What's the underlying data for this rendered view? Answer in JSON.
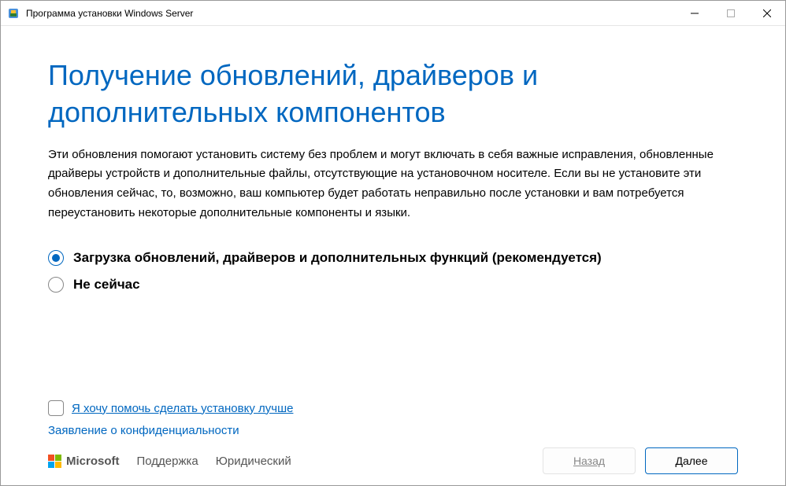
{
  "window": {
    "title": "Программа установки Windows Server"
  },
  "page": {
    "heading": "Получение обновлений, драйверов и дополнительных компонентов",
    "description": "Эти обновления помогают установить систему без проблем и могут включать в себя важные исправления, обновленные драйверы устройств и дополнительные файлы, отсутствующие на установочном носителе. Если вы не установите эти обновления сейчас, то, возможно, ваш компьютер будет работать неправильно после установки и вам потребуется переустановить некоторые дополнительные компоненты и языки."
  },
  "radios": {
    "download": "Загрузка обновлений, драйверов и дополнительных функций (рекомендуется)",
    "not_now": "Не сейчас"
  },
  "help_improve": {
    "label": "Я хочу помочь сделать установку лучше"
  },
  "privacy": {
    "label": "Заявление о конфиденциальности"
  },
  "footer": {
    "microsoft": "Microsoft",
    "support": "Поддержка",
    "legal": "Юридический",
    "back": "Назад",
    "next": "Далее"
  }
}
